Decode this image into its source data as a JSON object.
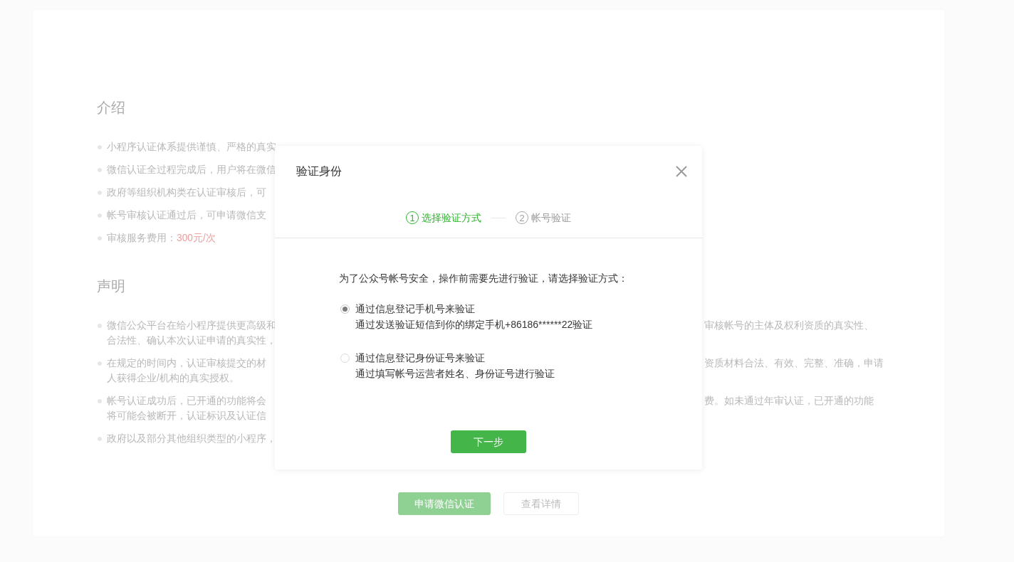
{
  "page": {
    "sections": [
      {
        "title": "介绍",
        "items": [
          {
            "lines": [
              {
                "text": "小程序认证体系提供谨慎、严格的真实"
              }
            ]
          },
          {
            "lines": [
              {
                "text": "微信认证全过程完成后，用户将在微信"
              }
            ]
          },
          {
            "lines": [
              {
                "text": "政府等组织机构类在认证审核后，可"
              }
            ]
          },
          {
            "lines": [
              {
                "text": "帐号审核认证通过后，可申请微信支"
              }
            ]
          },
          {
            "lines": [
              {
                "text": "审核服务费用：",
                "highlight": "300元/次"
              }
            ]
          }
        ]
      },
      {
        "title": "声明",
        "items": [
          {
            "lines": [
              {
                "text": "微信公众平台在给小程序提供更高级和",
                "text_right": "审核帐号的主体及权利资质的真实性、"
              },
              {
                "text": "合法性、确认本次认证申请的真实性，"
              }
            ]
          },
          {
            "lines": [
              {
                "text": "在规定的时间内，认证审核提交的材",
                "text_right": "资质材料合法、有效、完整、准确，申请"
              },
              {
                "text": "人获得企业/机构的真实授权。"
              }
            ]
          },
          {
            "lines": [
              {
                "text": "帐号认证成功后，已开通的功能将会",
                "text_right": "费。如未通过年审认证，已开通的功能"
              },
              {
                "text": "将可能会被断开，认证标识及认证信"
              }
            ]
          },
          {
            "lines": [
              {
                "text": "政府以及部分其他组织类型的小程序，"
              }
            ]
          }
        ]
      }
    ],
    "buttons": [
      {
        "label": "申请微信认证",
        "kind": "primary"
      },
      {
        "label": "查看详情",
        "kind": "default"
      }
    ]
  },
  "dialog": {
    "title": "验证身份",
    "steps": [
      {
        "number": "1",
        "label": "选择验证方式",
        "selected": true
      },
      {
        "number": "2",
        "label": "帐号验证",
        "selected": false
      }
    ],
    "instruction": "为了公众号帐号安全，操作前需要先进行验证，请选择验证方式：",
    "options": [
      {
        "title": "通过信息登记手机号来验证",
        "description": "通过发送验证短信到你的绑定手机+86186******22验证",
        "selected": true
      },
      {
        "title": "通过信息登记身份证号来验证",
        "description": "通过填写帐号运营者姓名、身份证号进行验证",
        "selected": false
      }
    ],
    "next_button": "下一步"
  }
}
